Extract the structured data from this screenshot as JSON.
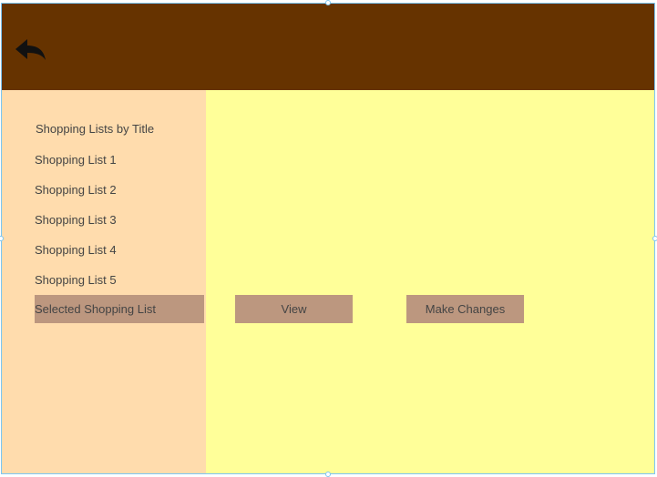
{
  "header": {
    "back_icon": "back-arrow-icon",
    "background_color": "#663300"
  },
  "sidebar": {
    "heading": "Shopping Lists by Title",
    "items": [
      {
        "label": "Shopping List 1"
      },
      {
        "label": "Shopping List 2"
      },
      {
        "label": "Shopping List 3"
      },
      {
        "label": "Shopping List 4"
      },
      {
        "label": "Shopping List 5"
      }
    ],
    "selected_label": "Selected Shopping List",
    "background_color": "#ffdcad"
  },
  "actions": {
    "view_label": "View",
    "make_changes_label": "Make Changes",
    "button_color": "#bc977f"
  },
  "main": {
    "background_color": "#ffff99"
  }
}
